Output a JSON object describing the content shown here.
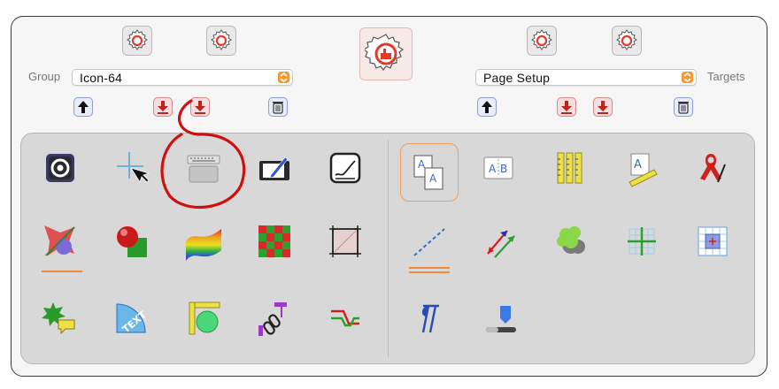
{
  "colors": {
    "accent": "#f09a3b",
    "annotation": "#d01010",
    "panel": "#d8d8d8"
  },
  "group": {
    "label": "Group",
    "value": "Icon-64"
  },
  "targets": {
    "label": "Targets",
    "value": "Page Setup"
  },
  "icons": {
    "gear_left_a": "gear-refresh-icon",
    "gear_left_b": "gear-refresh-icon",
    "gear_center": "gear-factory-icon",
    "gear_right_a": "gear-refresh-icon",
    "gear_right_b": "gear-refresh-icon"
  },
  "tools_left": [
    [
      "circle-lens-icon",
      "crosshair-cursor-icon",
      "keyboard-trackpad-icon",
      "drawing-tablet-icon",
      "signature-pad-icon"
    ],
    [
      "polygon-shape-icon",
      "sphere-cube-icon",
      "rainbow-ribbon-icon",
      "checkerboard-icon",
      "crop-frame-icon"
    ],
    [
      "speech-star-icon",
      "text-protractor-icon",
      "ruler-circle-icon",
      "chain-link-icon",
      "step-path-icon"
    ]
  ],
  "tools_right": [
    [
      "page-layout-icon",
      "ab-columns-icon",
      "yellow-rulers-icon",
      "text-ruler-icon",
      "ribbon-awareness-icon"
    ],
    [
      "dashed-line-icon",
      "double-arrow-icon",
      "cloud-shape-icon",
      "green-grid-icon",
      "blue-grid-icon"
    ],
    [
      "paragraph-icon",
      "pen-nib-stand-icon"
    ]
  ]
}
